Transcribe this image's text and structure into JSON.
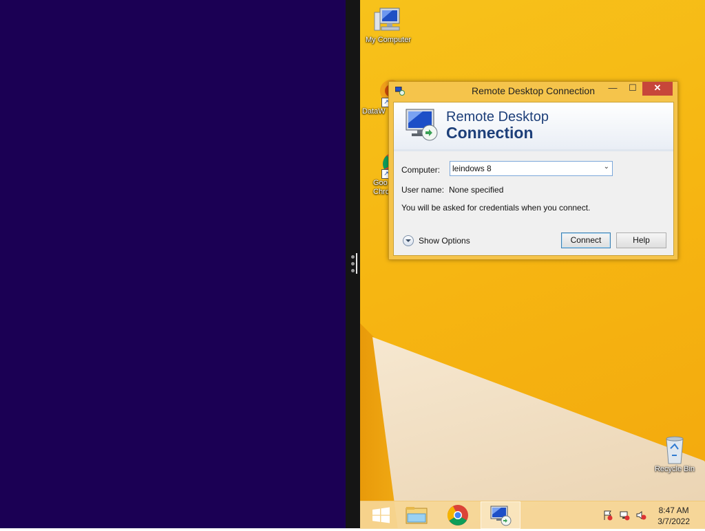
{
  "desktop_icons": {
    "my_computer": "My Computer",
    "datawrapper": "DataW",
    "chrome_line1": "Goo",
    "chrome_line2": "Chro",
    "recycle_bin": "Recycle Bin"
  },
  "dialog": {
    "title": "Remote Desktop Connection",
    "minimize": "—",
    "maximize": "☐",
    "close": "✕",
    "banner_line1": "Remote Desktop",
    "banner_line2": "Connection",
    "computer_label": "Computer:",
    "computer_value": "leindows 8",
    "username_label": "User name:",
    "username_value": "None specified",
    "credentials_note": "You will be asked for credentials when you connect.",
    "show_options": "Show Options",
    "connect_button": "Connect",
    "help_button": "Help"
  },
  "taskbar": {
    "time": "8:47 AM",
    "date": "3/7/2022"
  },
  "colors": {
    "left_pane": "#1b0054",
    "desktop": "#f6b612",
    "banner_text": "#1d3f79"
  }
}
